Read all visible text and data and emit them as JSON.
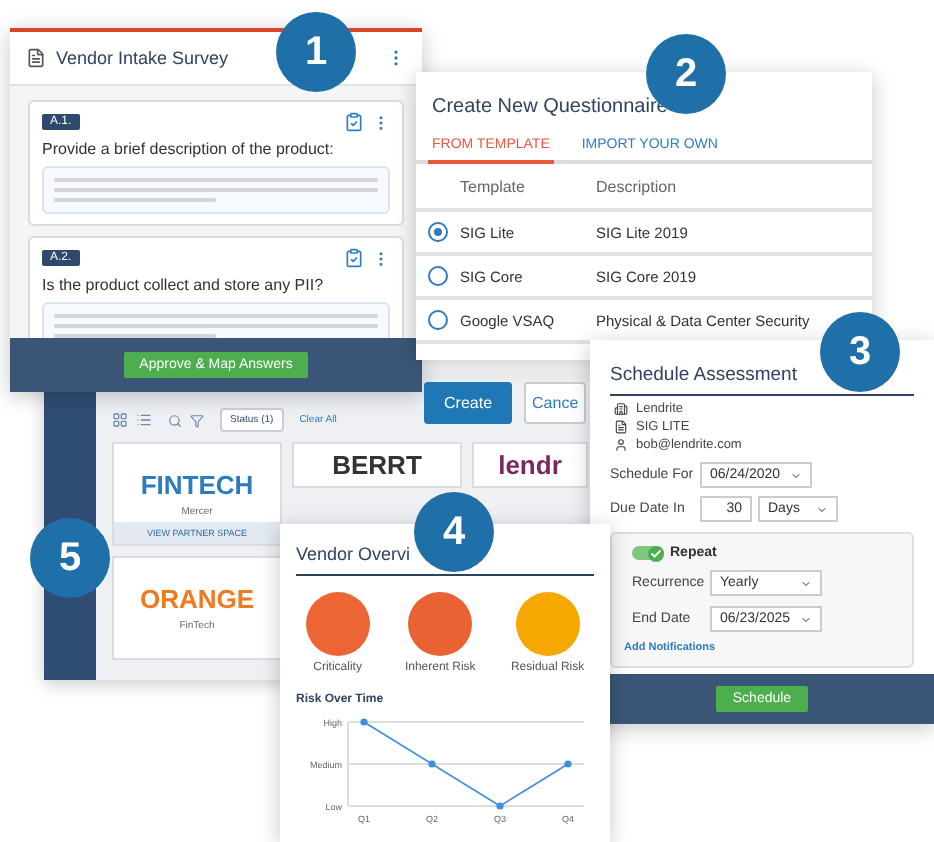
{
  "badges": [
    "1",
    "2",
    "3",
    "4",
    "5"
  ],
  "survey": {
    "title": "Vendor Intake Survey",
    "questions": [
      {
        "number": "A.1.",
        "text": "Provide a brief description of the product:"
      },
      {
        "number": "A.2.",
        "text": "Is the product collect and store any PII?"
      }
    ],
    "button": "Approve & Map Answers"
  },
  "questionnaire": {
    "title": "Create New Questionnaire",
    "tabs": [
      {
        "label": "FROM TEMPLATE",
        "selected": true
      },
      {
        "label": "IMPORT YOUR OWN",
        "selected": false
      }
    ],
    "columns": [
      "Template",
      "Description"
    ],
    "rows": [
      {
        "template": "SIG Lite",
        "description": "SIG Lite 2019",
        "selected": true
      },
      {
        "template": "SIG Core",
        "description": "SIG Core 2019",
        "selected": false
      },
      {
        "template": "Google VSAQ",
        "description": "Physical & Data Center Security",
        "selected": false
      }
    ],
    "buttons": [
      {
        "label": "Create",
        "kind": "primary"
      },
      {
        "label": "Cance",
        "kind": "secondary"
      }
    ]
  },
  "vendors": {
    "filter": "Status (1)",
    "clear": "Clear All",
    "tiles": [
      {
        "logo": "FINTECH",
        "color": "#2b7cc0",
        "name": "Mercer",
        "link": "VIEW PARTNER SPACE"
      },
      {
        "logo": "BERRT",
        "color": "#333333"
      },
      {
        "logo": "lendr",
        "color": "#7a2860"
      },
      {
        "logo": "ORANGE",
        "color": "#f07a1e",
        "name": "FinTech"
      }
    ]
  },
  "schedule": {
    "title": "Schedule Assessment",
    "vendor": "Lendrite",
    "template": "SIG LITE",
    "contact": "bob@lendrite.com",
    "fields": [
      {
        "label": "Schedule For",
        "value": "06/24/2020",
        "kind": "select"
      },
      {
        "label": "Due Date In",
        "value": "30",
        "unit": "Days",
        "kind": "duration"
      }
    ],
    "repeat": {
      "label": "Repeat",
      "on": true,
      "fields": [
        {
          "label": "Recurrence",
          "value": "Yearly"
        },
        {
          "label": "End Date",
          "value": "06/23/2025"
        }
      ],
      "link": "Add Notifications"
    },
    "button": "Schedule"
  },
  "overview": {
    "title": "Vendor Overvi",
    "ratings": [
      {
        "label": "Criticality",
        "color": "#ec6535"
      },
      {
        "label": "Inherent Risk",
        "color": "#e96233"
      },
      {
        "label": "Residual Risk",
        "color": "#f5a800"
      }
    ],
    "chart_title": "Risk Over Time",
    "chart": {
      "y_labels": [
        "High",
        "Medium",
        "Low"
      ],
      "x_labels": [
        "Q1",
        "Q2",
        "Q3",
        "Q4"
      ]
    }
  }
}
